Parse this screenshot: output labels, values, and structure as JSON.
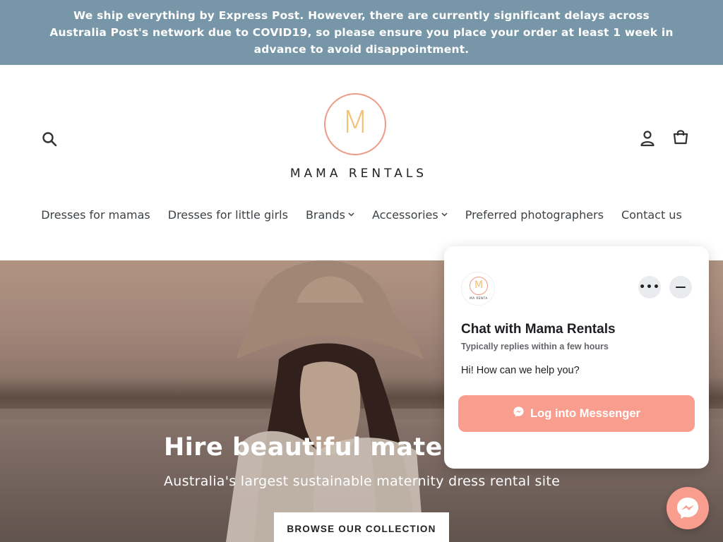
{
  "announcement": {
    "text": "We ship everything by Express Post. However, there are currently significant delays across Australia Post's network due to COVID19, so please ensure you place your order at least 1 week in advance to avoid disappointment."
  },
  "header": {
    "logo_letter": "M",
    "logo_text": "MAMA RENTALS"
  },
  "nav": {
    "items": [
      {
        "label": "Dresses for mamas"
      },
      {
        "label": "Dresses for little girls"
      },
      {
        "label": "Brands"
      },
      {
        "label": "Accessories"
      },
      {
        "label": "Preferred photographers"
      },
      {
        "label": "Contact us"
      }
    ],
    "caret": "⌄"
  },
  "hero": {
    "title": "Hire beautiful maternity",
    "subtitle": "Australia's largest sustainable maternity dress rental site",
    "cta": "BROWSE OUR COLLECTION"
  },
  "chat": {
    "avatar_letter": "M",
    "avatar_text": "MA RENTA",
    "more": "•••",
    "title": "Chat with Mama Rentals",
    "reply_time": "Typically replies within a few hours",
    "message": "Hi! How can we help you?",
    "login_label": "Log into Messenger"
  },
  "colors": {
    "announcement_bg": "#7796a8",
    "accent": "#f99d8e",
    "logo_ring": "#ee9a86",
    "logo_letter": "#f3c074"
  }
}
